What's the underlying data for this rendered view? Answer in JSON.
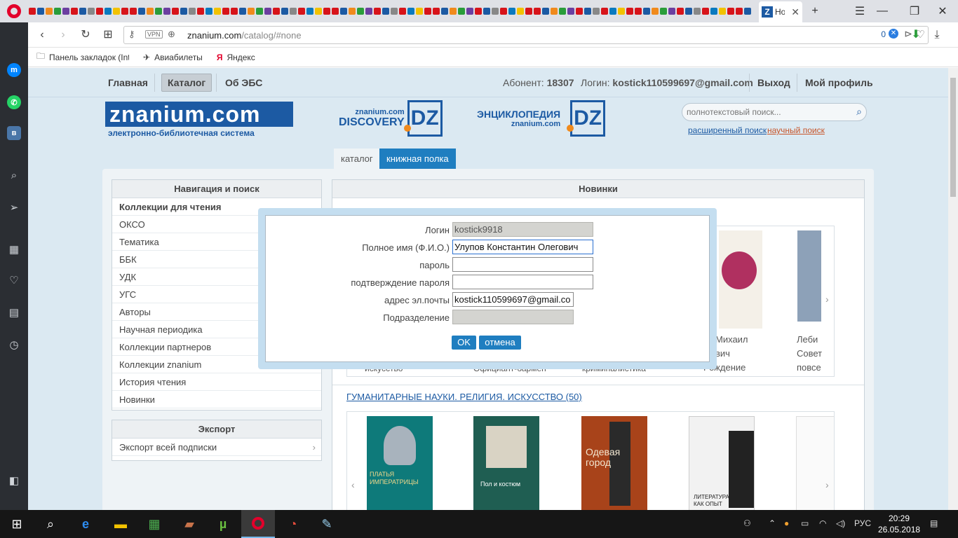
{
  "browser": {
    "active_tab_title": "Но",
    "url_host": "znanium.com",
    "url_path": "/catalog/#none",
    "vpn_label": "VPN",
    "blocker_count": "0",
    "bookmarks": [
      {
        "label": "Панель закладок (Int",
        "icon": "folder-icon"
      },
      {
        "label": "Авиабилеты",
        "icon": "airplane-icon"
      },
      {
        "label": "Яндекс",
        "icon": "yandex-icon"
      }
    ],
    "mini_tab_colors": [
      "#d7141a",
      "#1c5aa3",
      "#f08a1c",
      "#2a9d3a",
      "#6b3fa0",
      "#d7141a",
      "#1c5aa3",
      "#888888",
      "#d7141a",
      "#0a7abf",
      "#f2c200",
      "#d7141a"
    ]
  },
  "site": {
    "nav": {
      "home": "Главная",
      "catalog": "Каталог",
      "about": "Об ЭБС",
      "subscriber_label": "Абонент:",
      "subscriber_value": "18307",
      "login_label": "Логин:",
      "login_value": "kostick110599697@gmail.com",
      "logout": "Выход",
      "profile": "Мой профиль"
    },
    "logo_main": "znanium.com",
    "logo_sub": "электронно-библиотечная система",
    "discovery_top": "znanium.com",
    "discovery_main": "DISCOVERY",
    "encyclopedia_main": "ЭНЦИКЛОПЕДИЯ",
    "encyclopedia_sub": "znanium.com",
    "dz": "DZ",
    "search_placeholder": "полнотекстовый поиск...",
    "advanced_search": "расширенный поиск",
    "scientific_search": "научный поиск",
    "tabs": {
      "catalog": "каталог",
      "shelf": "книжная полка"
    },
    "nav_panel": {
      "title": "Навигация и поиск",
      "items": [
        "Коллекции для чтения",
        "ОКСО",
        "Тематика",
        "ББК",
        "УДК",
        "УГС",
        "Авторы",
        "Научная периодика",
        "Коллекции партнеров",
        "Коллекции znanium",
        "История чтения",
        "Новинки"
      ]
    },
    "export_panel": {
      "title": "Экспорт",
      "item": "Экспорт всей подписки"
    },
    "news_panel": {
      "title": "Новинки",
      "row1_frags": [
        "Михаил",
        "вич",
        "Рождение",
        "Леби",
        "Совет",
        "повсе",
        "искусство",
        "Официант-бармен",
        "криминалистика"
      ],
      "section_link": "ГУМАНИТАРНЫЕ НАУКИ. РЕЛИГИЯ. ИСКУССТВО (50)",
      "row2_book_texts": [
        "ПЛАТЬЯ ИМПЕРАТРИЦЫ",
        "Пол и костюм",
        "Одевая город",
        "ЛИТЕРАТУРА КАК ОПЫТ"
      ]
    }
  },
  "dialog": {
    "login_label": "Логин",
    "login_value": "kostick9918",
    "fullname_label": "Полное имя (Ф.И.О.)",
    "fullname_value": "Улупов Константин Олегович",
    "password_label": "пароль",
    "password_value": "",
    "confirm_label": "подтверждение пароля",
    "confirm_value": "",
    "email_label": "адрес эл.почты",
    "email_value": "kostick110599697@gmail.co",
    "division_label": "Подразделение",
    "division_value": "",
    "ok": "OK",
    "cancel": "отмена"
  },
  "taskbar": {
    "lang": "РУС",
    "time": "20:29",
    "date": "26.05.2018"
  },
  "colors": {
    "brand": "#1c5aa3",
    "accent_orange": "#f08a1c",
    "button": "#1f7ec0",
    "opera_red": "#e3002b"
  }
}
